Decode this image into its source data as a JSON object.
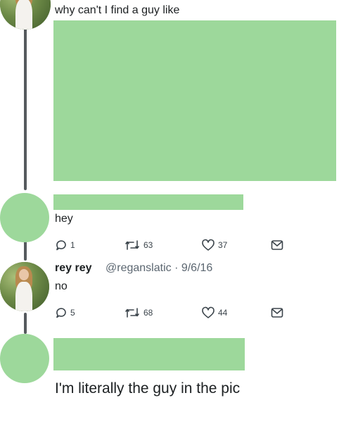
{
  "tweet_top": {
    "text": "why can't I find a guy like"
  },
  "reply_one": {
    "text": "hey",
    "actions": {
      "replies": "1",
      "retweets": "63",
      "likes": "37"
    }
  },
  "reply_two": {
    "display_name": "rey rey",
    "handle_date": "@reganslatic · 9/6/16",
    "text": "no",
    "actions": {
      "replies": "5",
      "retweets": "68",
      "likes": "44"
    }
  },
  "reply_three": {
    "text": "I'm literally the guy in the pic"
  },
  "icons": [
    "reply-icon",
    "retweet-icon",
    "heart-icon",
    "dm-icon"
  ],
  "colors": {
    "redaction_green": "#9dd89b",
    "thread_line": "#555a5e",
    "meta_gray": "#5b6670"
  }
}
